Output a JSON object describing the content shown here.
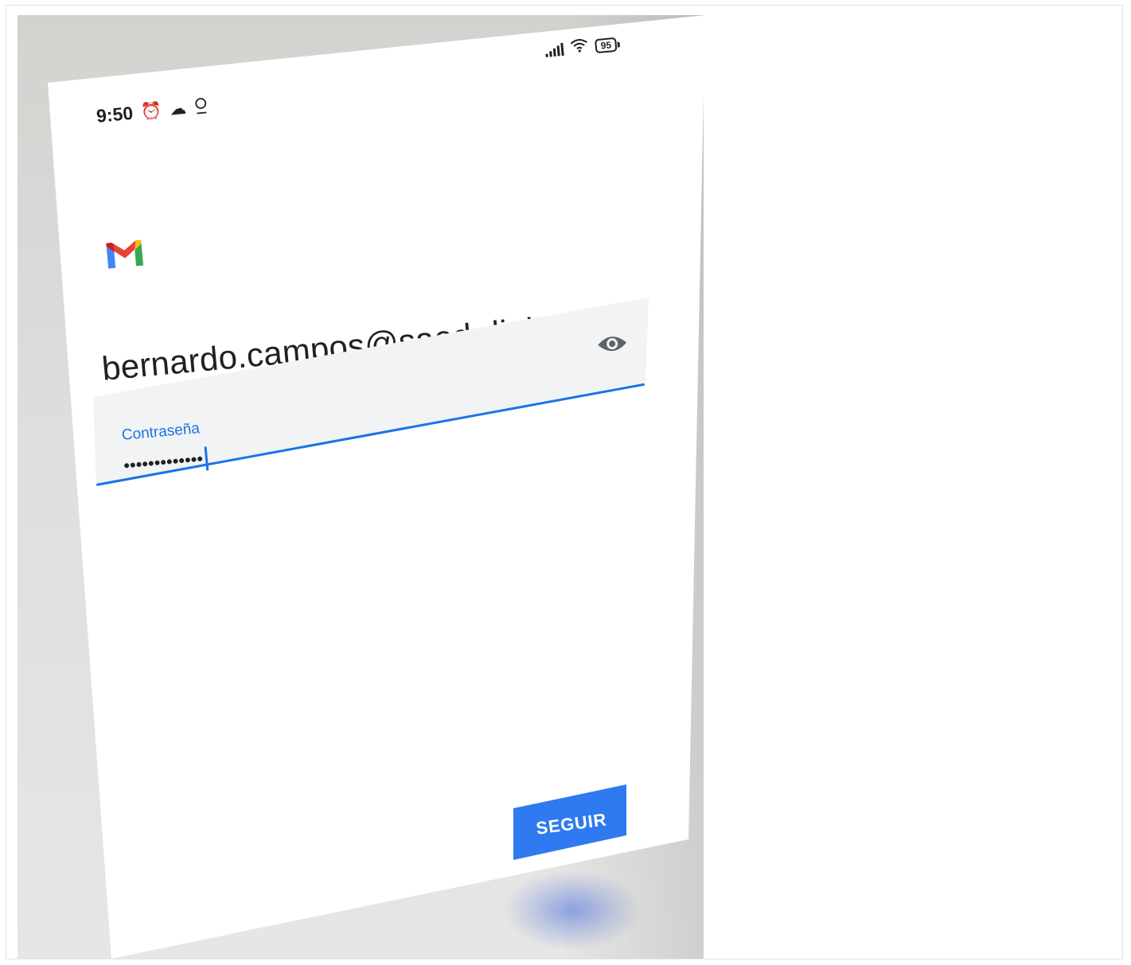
{
  "status_bar": {
    "time": "9:50",
    "left_icons": [
      "alarm-icon",
      "cloud-icon",
      "location-icon"
    ],
    "right_icons": [
      "signal-icon",
      "wifi-icon",
      "battery-icon"
    ],
    "battery_level": "95"
  },
  "app": {
    "logo": "gmail-icon",
    "account_email": "bernardo.campos@saed.digital"
  },
  "password_field": {
    "label": "Contraseña",
    "value": "•••••••••••••",
    "toggle_icon": "eye-icon"
  },
  "actions": {
    "next_label": "SEGUIR"
  },
  "colors": {
    "accent": "#1a73e8",
    "button": "#2f7af0",
    "field_bg": "#f1f3f4",
    "text": "#202124"
  }
}
